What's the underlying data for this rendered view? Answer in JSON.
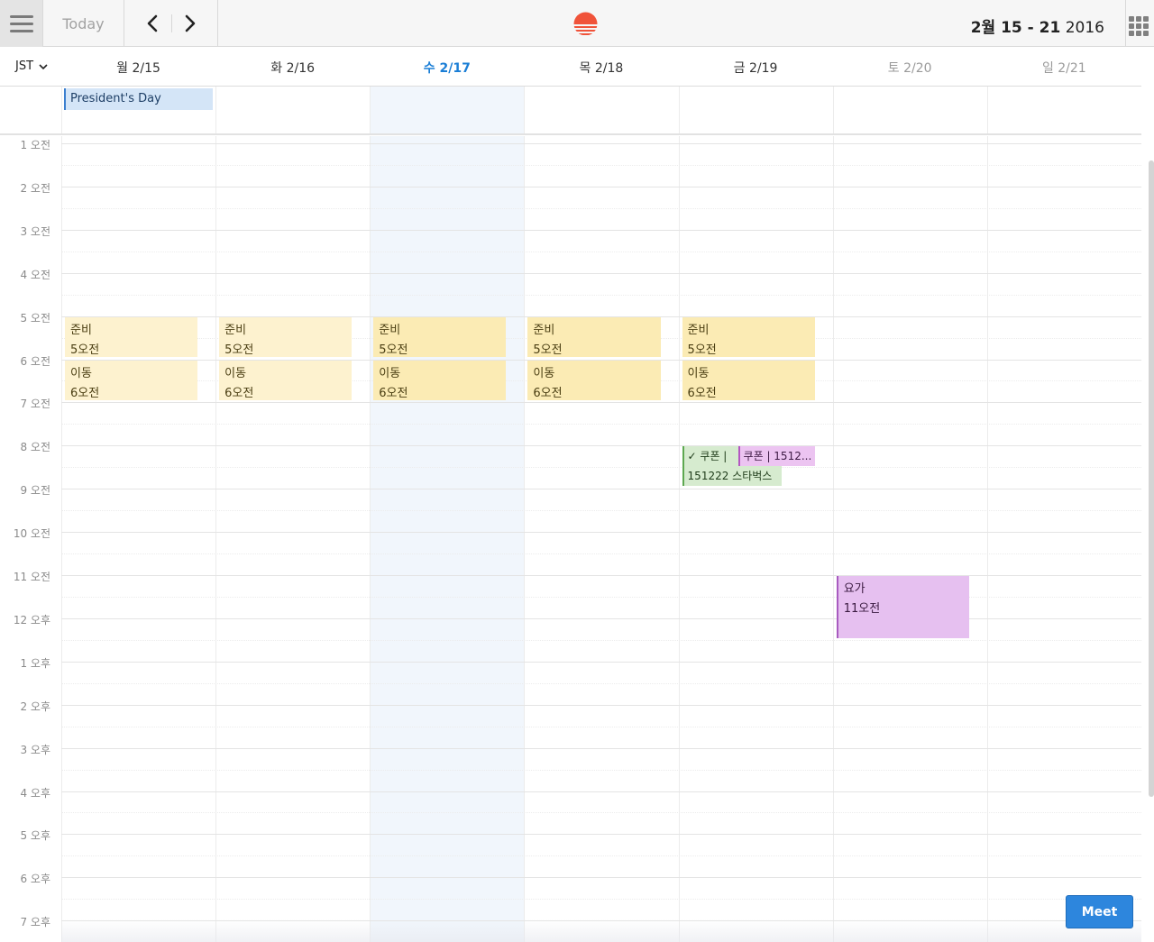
{
  "toolbar": {
    "today_label": "Today",
    "date_range": {
      "month_day": "2월 15 - 21",
      "year": "2016"
    },
    "logo_color": "#f0533a"
  },
  "timezone": {
    "label": "JST"
  },
  "days": [
    {
      "label": "월 2/15",
      "kind": "weekday"
    },
    {
      "label": "화 2/16",
      "kind": "weekday"
    },
    {
      "label": "수 2/17",
      "kind": "today"
    },
    {
      "label": "목 2/18",
      "kind": "weekday"
    },
    {
      "label": "금 2/19",
      "kind": "weekday"
    },
    {
      "label": "토 2/20",
      "kind": "weekend"
    },
    {
      "label": "일 2/21",
      "kind": "weekend"
    }
  ],
  "all_day_events": [
    {
      "day": 0,
      "title": "President's Day",
      "color": "#d4e5f7"
    }
  ],
  "hours": [
    "1 오전",
    "2 오전",
    "3 오전",
    "4 오전",
    "5 오전",
    "6 오전",
    "7 오전",
    "8 오전",
    "9 오전",
    "10 오전",
    "11 오전",
    "12 오후",
    "1 오후",
    "2 오후",
    "3 오후",
    "4 오후",
    "5 오후",
    "6 오후",
    "7 오후"
  ],
  "events": [
    {
      "day": 0,
      "start": 5,
      "end": 6,
      "title": "준비",
      "time": "5오전",
      "style": "yellow-light"
    },
    {
      "day": 0,
      "start": 6,
      "end": 7,
      "title": "이동",
      "time": "6오전",
      "style": "yellow-light"
    },
    {
      "day": 1,
      "start": 5,
      "end": 6,
      "title": "준비",
      "time": "5오전",
      "style": "yellow-light"
    },
    {
      "day": 1,
      "start": 6,
      "end": 7,
      "title": "이동",
      "time": "6오전",
      "style": "yellow-light"
    },
    {
      "day": 2,
      "start": 5,
      "end": 6,
      "title": "준비",
      "time": "5오전",
      "style": "yellow"
    },
    {
      "day": 2,
      "start": 6,
      "end": 7,
      "title": "이동",
      "time": "6오전",
      "style": "yellow"
    },
    {
      "day": 3,
      "start": 5,
      "end": 6,
      "title": "준비",
      "time": "5오전",
      "style": "yellow"
    },
    {
      "day": 3,
      "start": 6,
      "end": 7,
      "title": "이동",
      "time": "6오전",
      "style": "yellow"
    },
    {
      "day": 4,
      "start": 5,
      "end": 6,
      "title": "준비",
      "time": "5오전",
      "style": "yellow"
    },
    {
      "day": 4,
      "start": 6,
      "end": 7,
      "title": "이동",
      "time": "6오전",
      "style": "yellow"
    },
    {
      "day": 5,
      "start": 11,
      "end": 12.5,
      "title": "요가",
      "time": "11오전",
      "style": "lavender"
    }
  ],
  "coupon_events": [
    {
      "title": "✓ 쿠폰 |",
      "subtitle": "151222 스타벅스",
      "style": "green"
    },
    {
      "title": "쿠폰 | 1512...",
      "style": "pink"
    }
  ],
  "meet_label": "Meet"
}
